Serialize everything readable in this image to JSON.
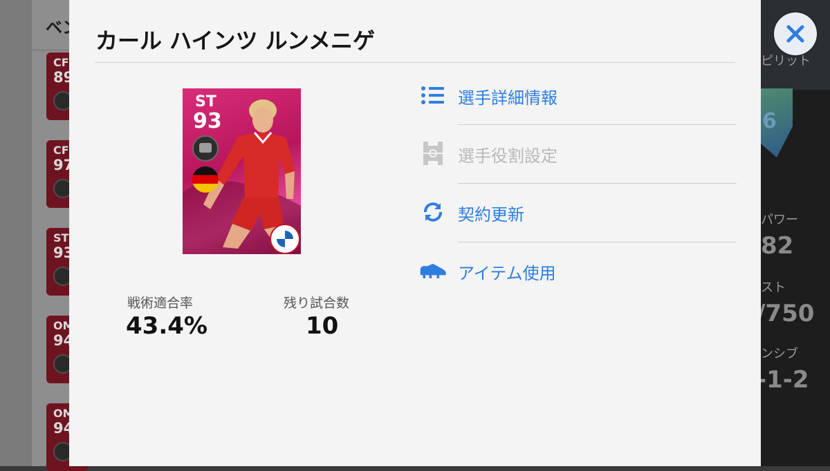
{
  "background": {
    "left_header": "ベン",
    "cards": [
      {
        "pos": "CF",
        "rating": "89"
      },
      {
        "pos": "CF",
        "rating": "97"
      },
      {
        "pos": "ST",
        "rating": "93"
      },
      {
        "pos": "OM",
        "rating": "94"
      },
      {
        "pos": "OM",
        "rating": "94"
      }
    ],
    "right_panel": {
      "spirit_label": "ピリット",
      "shield_digit": "6",
      "power_label": "パワー",
      "power_value": "82",
      "cost_label": "スト",
      "cost_value": "/750",
      "chem_label": "ンシブ",
      "chem_value": "-1-2"
    }
  },
  "modal": {
    "title": "カール ハインツ ルンメニゲ",
    "close_icon": "close-icon",
    "player_card": {
      "position": "ST",
      "rating": "93",
      "nationality_flag": "germany-flag",
      "club_crest": "fc-bayern-munchen-crest"
    },
    "stats": {
      "tactics_label": "戦術適合率",
      "tactics_value": "43.4%",
      "matches_label": "残り試合数",
      "matches_value": "10"
    },
    "menu": [
      {
        "label": "選手詳細情報",
        "icon": "list-icon",
        "enabled": true
      },
      {
        "label": "選手役割設定",
        "icon": "pitch-icon",
        "enabled": false
      },
      {
        "label": "契約更新",
        "icon": "refresh-icon",
        "enabled": true
      },
      {
        "label": "アイテム使用",
        "icon": "boot-icon",
        "enabled": true
      }
    ],
    "colors": {
      "accent": "#2e7ee0",
      "disabled": "#b9b9b9",
      "card": "#d92d79"
    }
  }
}
